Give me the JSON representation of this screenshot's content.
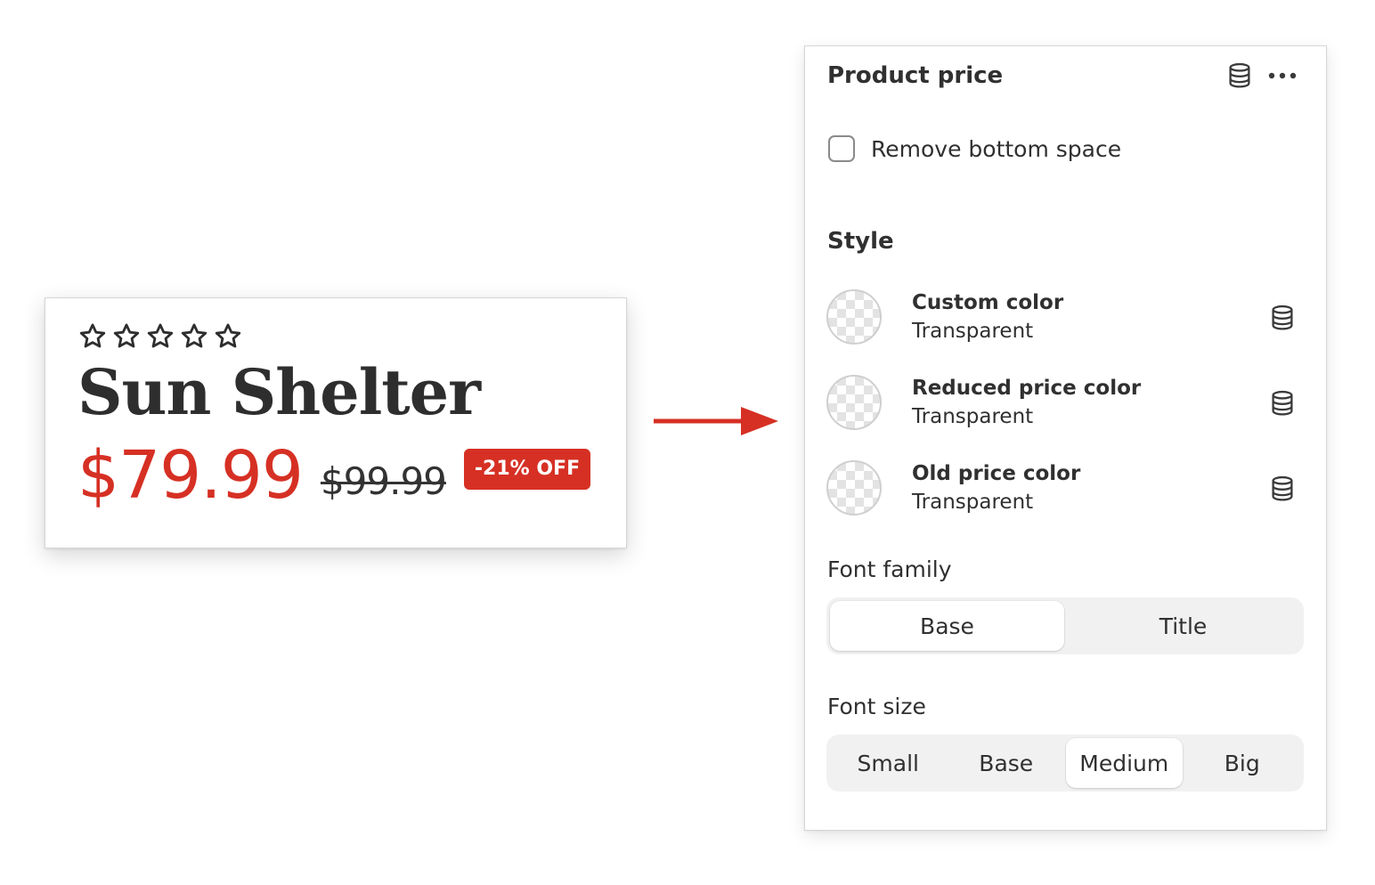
{
  "preview": {
    "rating": {
      "filled": 0,
      "total": 5
    },
    "title": "Sun Shelter",
    "price": "$79.99",
    "old_price": "$99.99",
    "badge": "-21% OFF"
  },
  "colors": {
    "accent_red": "#d63024",
    "text_dark": "#303030",
    "panel_border": "#d6d6d6"
  },
  "panel": {
    "title": "Product price",
    "header_icons": [
      "database-icon",
      "more-icon"
    ],
    "remove_bottom_space": {
      "label": "Remove bottom space",
      "checked": false
    },
    "style_title": "Style",
    "color_settings": [
      {
        "name": "Custom color",
        "value": "Transparent"
      },
      {
        "name": "Reduced price color",
        "value": "Transparent"
      },
      {
        "name": "Old price color",
        "value": "Transparent"
      }
    ],
    "font_family": {
      "label": "Font family",
      "options": [
        "Base",
        "Title"
      ],
      "selected": "Base"
    },
    "font_size": {
      "label": "Font size",
      "options": [
        "Small",
        "Base",
        "Medium",
        "Big"
      ],
      "selected": "Medium"
    }
  }
}
